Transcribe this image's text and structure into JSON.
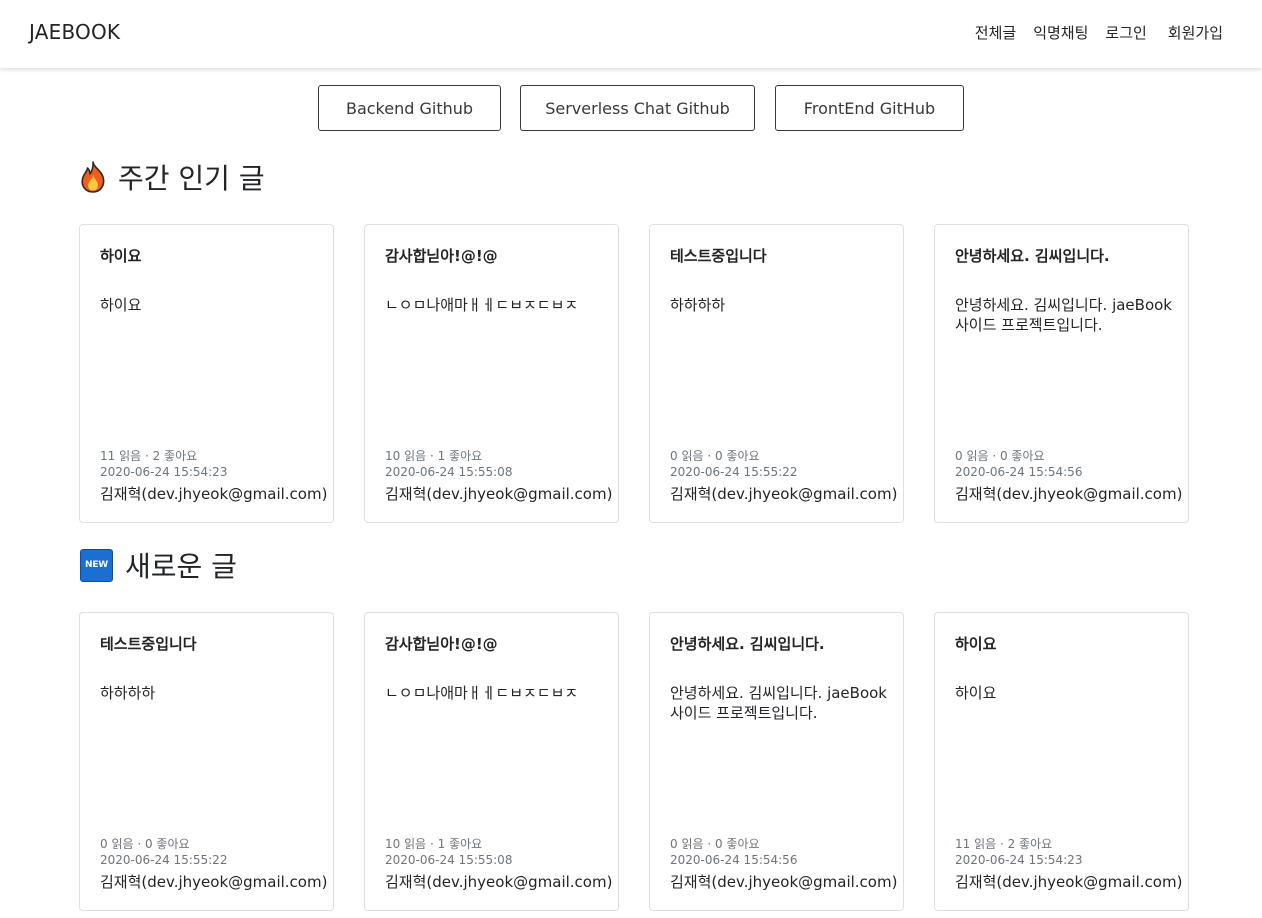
{
  "navbar": {
    "brand": "JAEBOOK",
    "links": [
      "전체글",
      "익명채팅",
      "로그인",
      "회원가입"
    ]
  },
  "github_buttons": [
    "Backend Github",
    "Serverless Chat Github",
    "FrontEnd GitHub"
  ],
  "sections": [
    {
      "title": "주간 인기 글",
      "icon": "fire-icon",
      "cards": [
        {
          "title": "하이요",
          "body": "하이요",
          "stats": "11 읽음 · 2 좋아요",
          "date": "2020-06-24 15:54:23",
          "author": "김재혁(dev.jhyeok@gmail.com)"
        },
        {
          "title": "감사합닏아!@!@",
          "body": "ㄴㅇㅁ나애마ㅐㅔㄷㅂㅈㄷㅂㅈ",
          "stats": "10 읽음 · 1 좋아요",
          "date": "2020-06-24 15:55:08",
          "author": "김재혁(dev.jhyeok@gmail.com)"
        },
        {
          "title": "테스트중입니다",
          "body": "하하하하",
          "stats": "0 읽음 · 0 좋아요",
          "date": "2020-06-24 15:55:22",
          "author": "김재혁(dev.jhyeok@gmail.com)"
        },
        {
          "title": "안녕하세요. 김씨입니다.",
          "body": "안녕하세요. 김씨입니다. jaeBook 사이드 프로젝트입니다.",
          "stats": "0 읽음 · 0 좋아요",
          "date": "2020-06-24 15:54:56",
          "author": "김재혁(dev.jhyeok@gmail.com)"
        }
      ]
    },
    {
      "title": "새로운 글",
      "icon": "new-icon",
      "icon_text": "NEW",
      "cards": [
        {
          "title": "테스트중입니다",
          "body": "하하하하",
          "stats": "0 읽음 · 0 좋아요",
          "date": "2020-06-24 15:55:22",
          "author": "김재혁(dev.jhyeok@gmail.com)"
        },
        {
          "title": "감사합닏아!@!@",
          "body": "ㄴㅇㅁ나애마ㅐㅔㄷㅂㅈㄷㅂㅈ",
          "stats": "10 읽음 · 1 좋아요",
          "date": "2020-06-24 15:55:08",
          "author": "김재혁(dev.jhyeok@gmail.com)"
        },
        {
          "title": "안녕하세요. 김씨입니다.",
          "body": "안녕하세요. 김씨입니다. jaeBook 사이드 프로젝트입니다.",
          "stats": "0 읽음 · 0 좋아요",
          "date": "2020-06-24 15:54:56",
          "author": "김재혁(dev.jhyeok@gmail.com)"
        },
        {
          "title": "하이요",
          "body": "하이요",
          "stats": "11 읽음 · 2 좋아요",
          "date": "2020-06-24 15:54:23",
          "author": "김재혁(dev.jhyeok@gmail.com)"
        }
      ]
    }
  ]
}
